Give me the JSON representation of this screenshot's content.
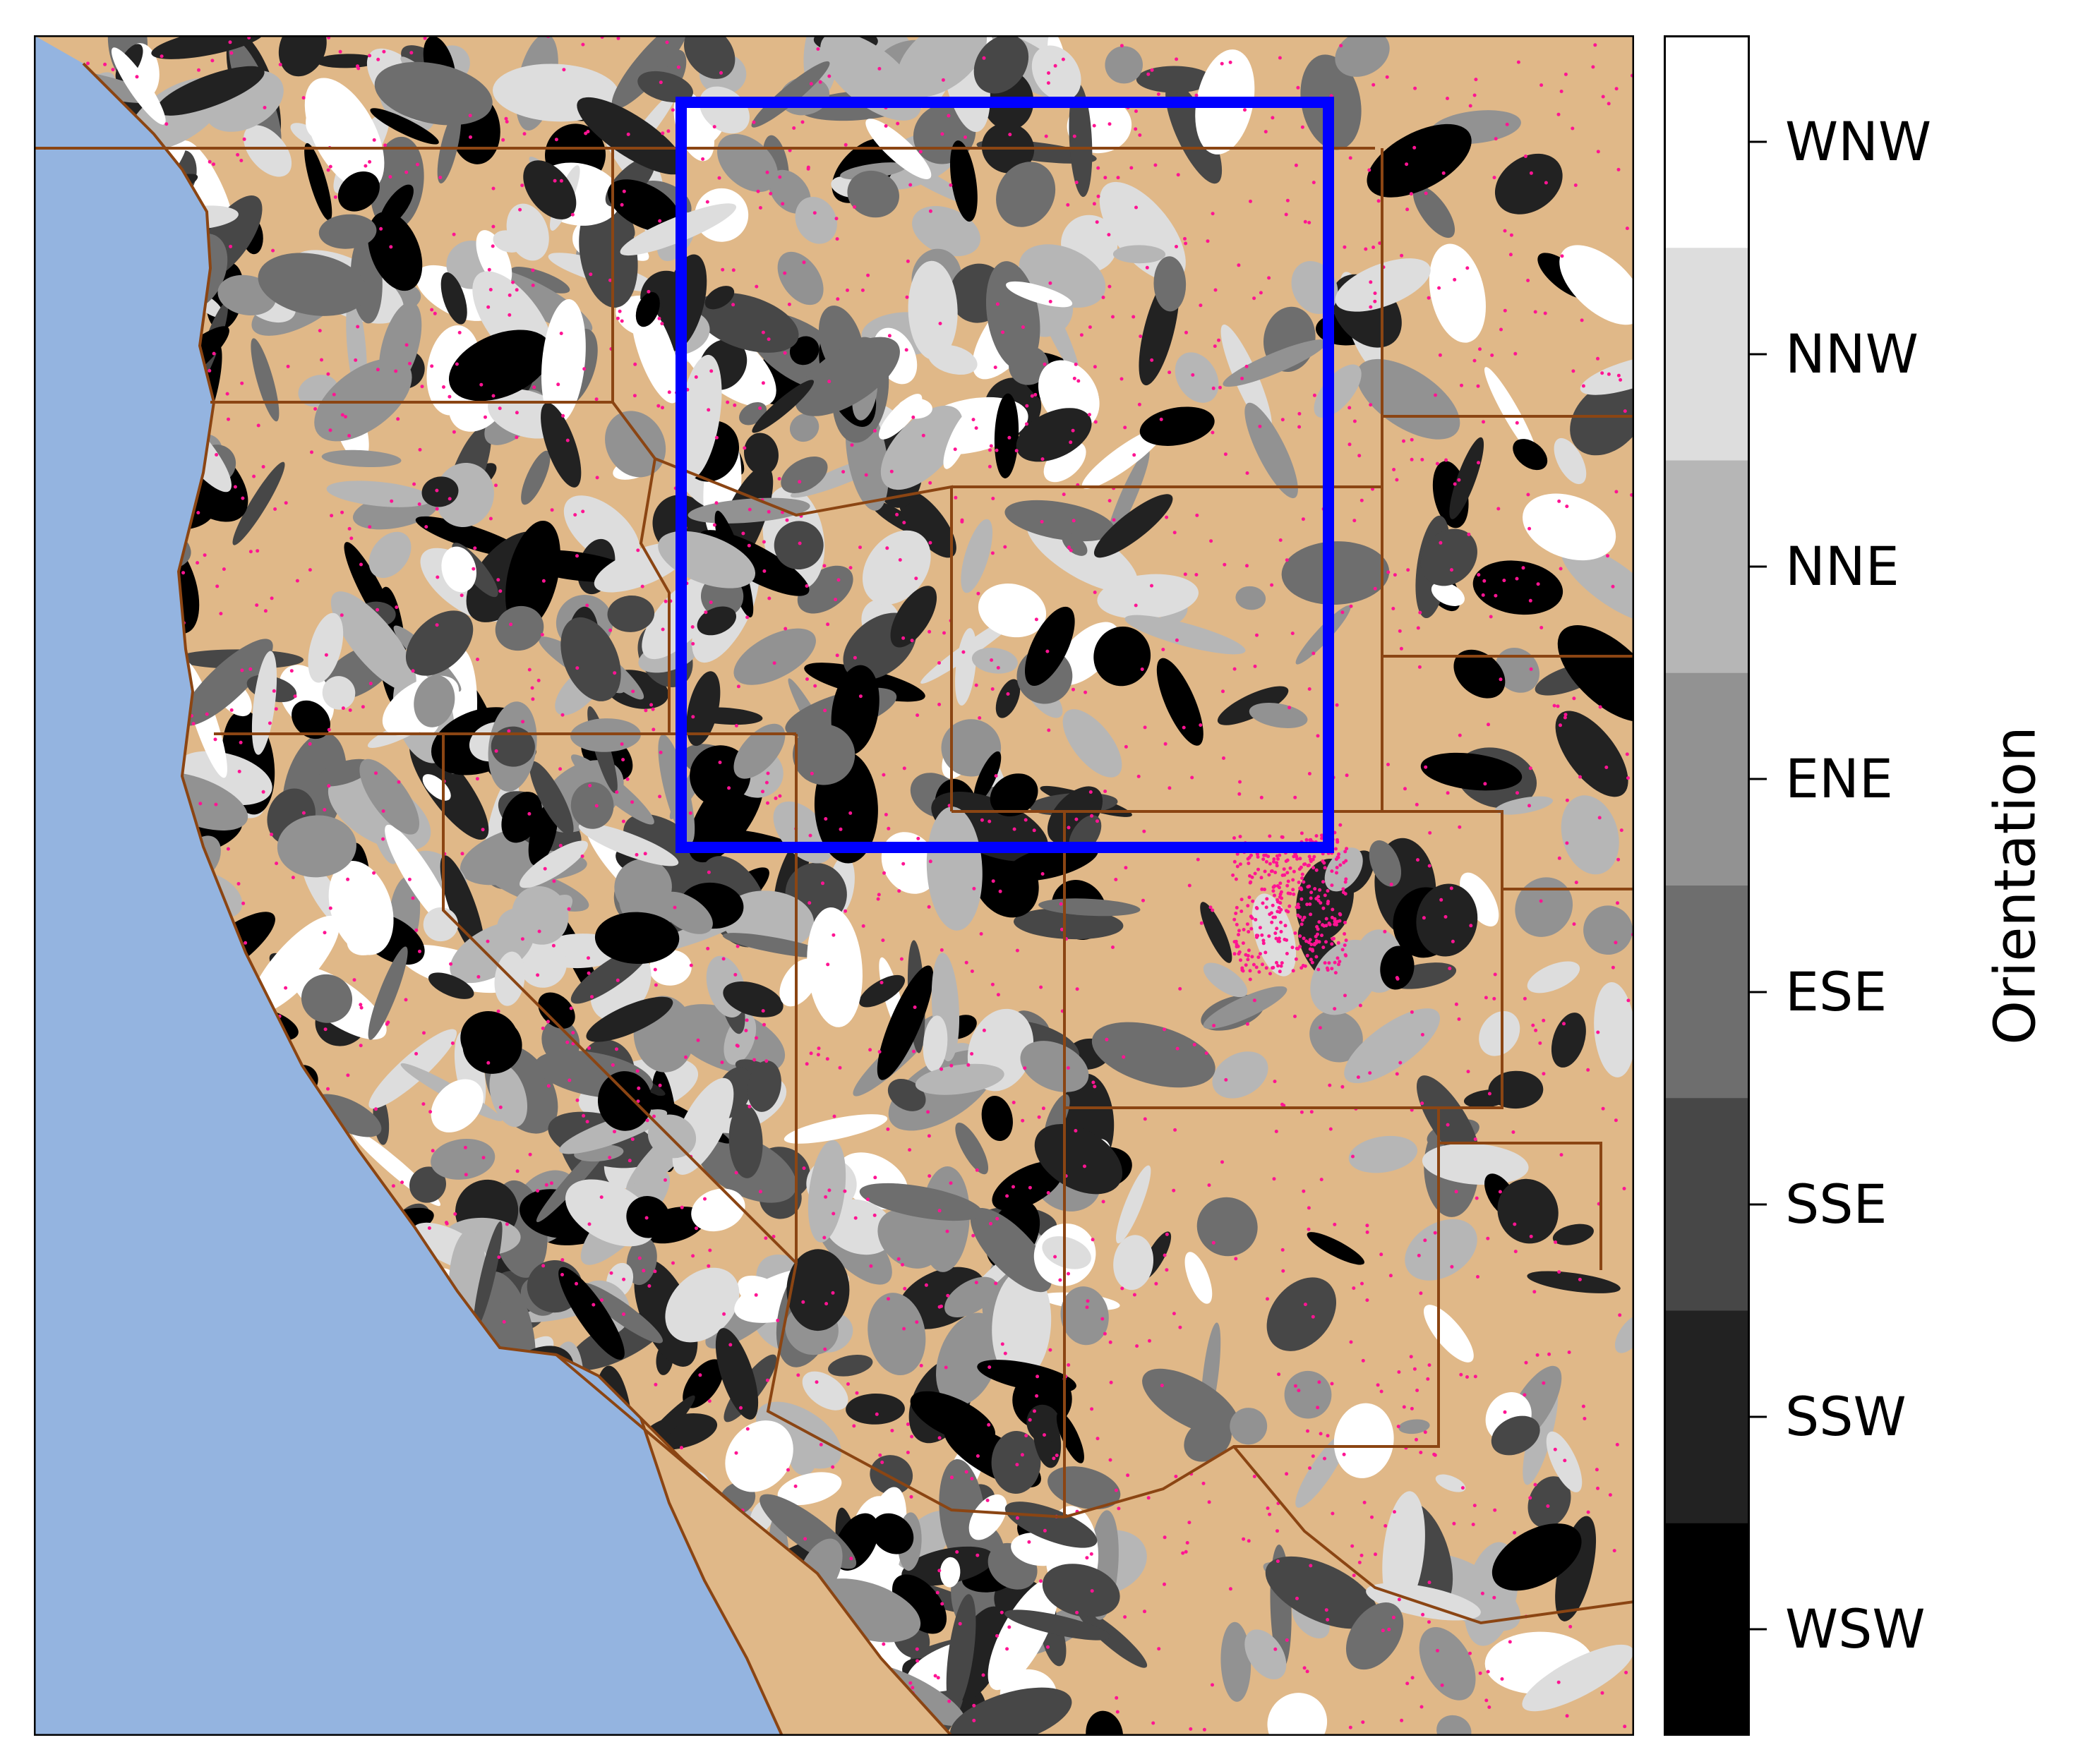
{
  "map": {
    "region": "Western United States",
    "colors": {
      "ocean": "#94b4e0",
      "land": "#e0b888",
      "borders": "#8b4513",
      "stations": "#ff1493",
      "highlight_box": "#0000ff"
    }
  },
  "colorbar": {
    "title": "Orientation",
    "labels": [
      "WNW",
      "NNW",
      "NNE",
      "ENE",
      "ESE",
      "SSE",
      "SSW",
      "WSW"
    ],
    "colors": [
      "#ffffff",
      "#dddddd",
      "#b6b6b6",
      "#929292",
      "#6e6e6e",
      "#474747",
      "#222222",
      "#000000"
    ]
  }
}
